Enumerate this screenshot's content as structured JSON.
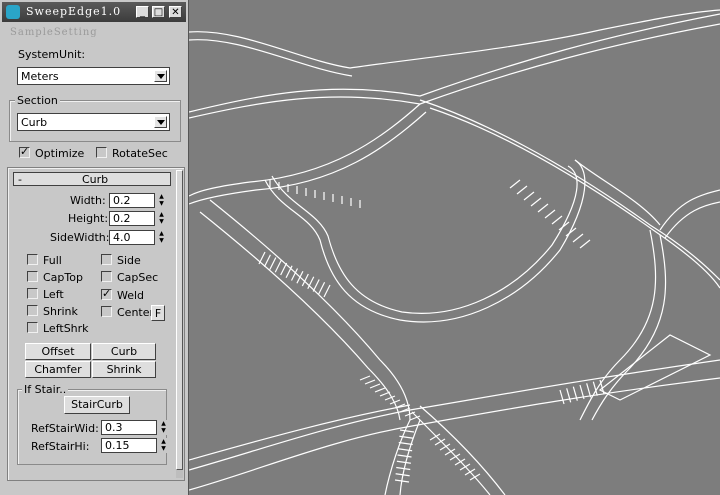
{
  "window": {
    "title": "SweepEdge1.0",
    "subtitle": "SampleSetting"
  },
  "system_unit": {
    "label": "SystemUnit:",
    "value": "Meters"
  },
  "section": {
    "label": "Section",
    "value": "Curb"
  },
  "options": {
    "optimize_label": "Optimize",
    "optimize_checked": true,
    "rotatesec_label": "RotateSec",
    "rotatesec_checked": false
  },
  "rollout": {
    "toggle": "-",
    "title": "Curb"
  },
  "params": {
    "width_label": "Width:",
    "width_value": "0.2",
    "height_label": "Height:",
    "height_value": "0.2",
    "sidewidth_label": "SideWidth:",
    "sidewidth_value": "4.0"
  },
  "checks": {
    "full": "Full",
    "captop": "CapTop",
    "left": "Left",
    "shrink": "Shrink",
    "leftshrk": "LeftShrk",
    "side": "Side",
    "capsec": "CapSec",
    "weld": "Weld",
    "center": "Center",
    "center_btn": "F",
    "weld_checked": true
  },
  "buttons": {
    "offset": "Offset",
    "curb": "Curb",
    "chamfer": "Chamfer",
    "shrink": "Shrink"
  },
  "stair": {
    "group_label": "If Stair..",
    "button": "StairCurb",
    "refwid_label": "RefStairWid:",
    "refwid_value": "0.3",
    "refhi_label": "RefStairHi:",
    "refhi_value": "0.15"
  },
  "colors": {
    "viewport_bg": "#7d7d7d",
    "panel_bg": "#c8c8c8",
    "wire": "#ffffff"
  }
}
